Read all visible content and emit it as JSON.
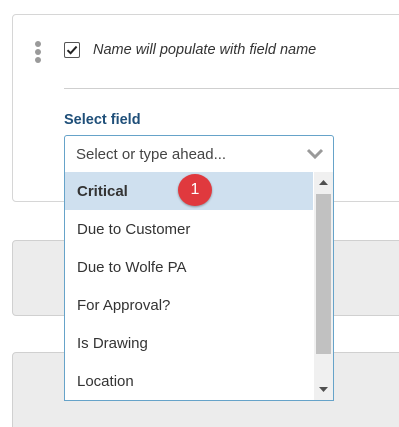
{
  "field_row": {
    "checkbox_checked": true,
    "checkbox_label": "Name will populate with field name"
  },
  "select": {
    "label": "Select field",
    "placeholder": "Select or type ahead...",
    "options": [
      "Critical",
      "Due to Customer",
      "Due to Wolfe PA",
      "For Approval?",
      "Is Drawing",
      "Location"
    ],
    "highlighted_option": "Critical"
  },
  "annotation": {
    "badge_number": "1",
    "badge_color": "#e0393e"
  },
  "colors": {
    "accent_border": "#66a3c9",
    "label_text": "#1f4f79",
    "highlight_bg": "#cfe0ef"
  }
}
